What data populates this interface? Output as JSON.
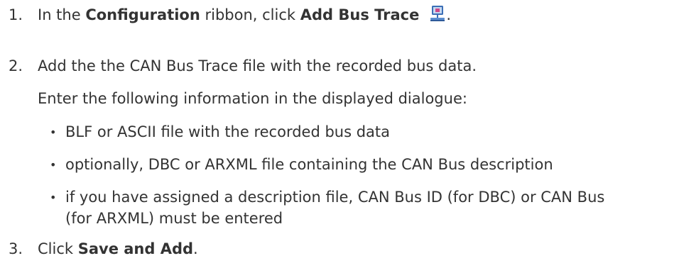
{
  "steps": [
    {
      "number": "1.",
      "pre": "In the ",
      "bold1": "Configuration",
      "mid": " ribbon, click ",
      "bold2": "Add Bus Trace",
      "icon": "bus-trace-icon",
      "post": "."
    },
    {
      "number": "2.",
      "text": "Add the the CAN Bus Trace file with the recorded bus data.",
      "subtext": "Enter the following information in the displayed dialogue:",
      "bullets": [
        "BLF or ASCII file with the recorded bus data",
        "optionally, DBC or ARXML file containing the CAN Bus description",
        "if you have assigned a description file, CAN Bus ID (for DBC) or CAN Bus"
      ],
      "bullet3_cont": "(for ARXML) must be entered"
    },
    {
      "number": "3.",
      "pre": "Click ",
      "bold": "Save and Add",
      "post": "."
    }
  ],
  "colors": {
    "text": "#333333",
    "icon_blue": "#3b6fb6",
    "icon_screen": "#c8d8f0",
    "icon_accent": "#cc4a8a"
  }
}
